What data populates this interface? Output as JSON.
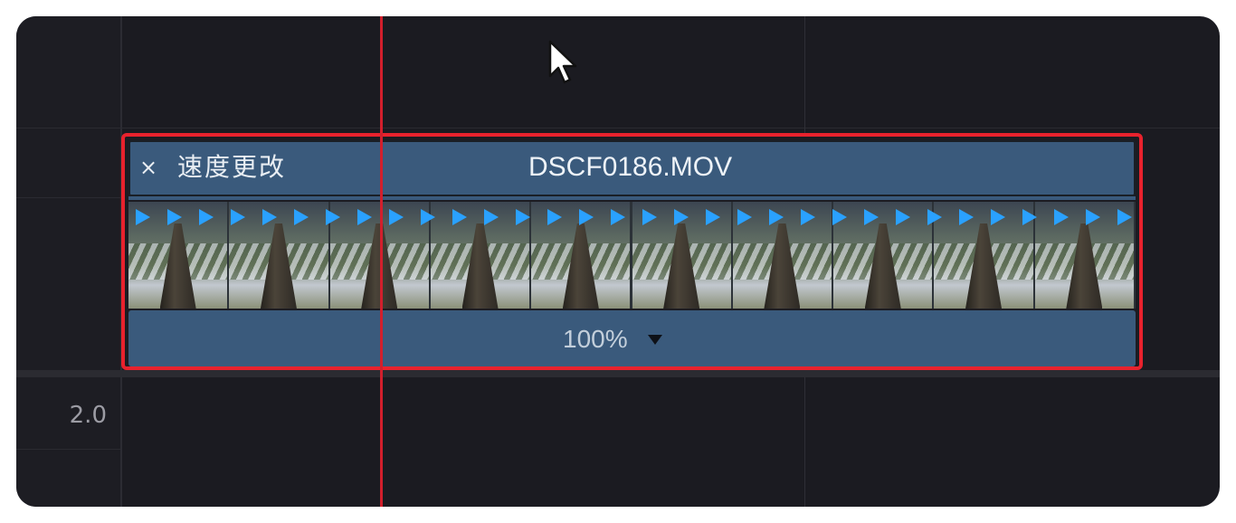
{
  "timeline": {
    "track_label": "2.0",
    "clip": {
      "effect_label": "速度更改",
      "close_icon": "×",
      "name": "DSCF0186.MOV",
      "speed_value": "100%",
      "speed_dropdown_icon": "triangle-down-icon",
      "selection_color": "#e8222d",
      "clip_color": "#3a5a7c",
      "speed_marker_color": "#2aa1ff",
      "frame_count": 10
    },
    "playhead_color": "#d21f2c"
  }
}
